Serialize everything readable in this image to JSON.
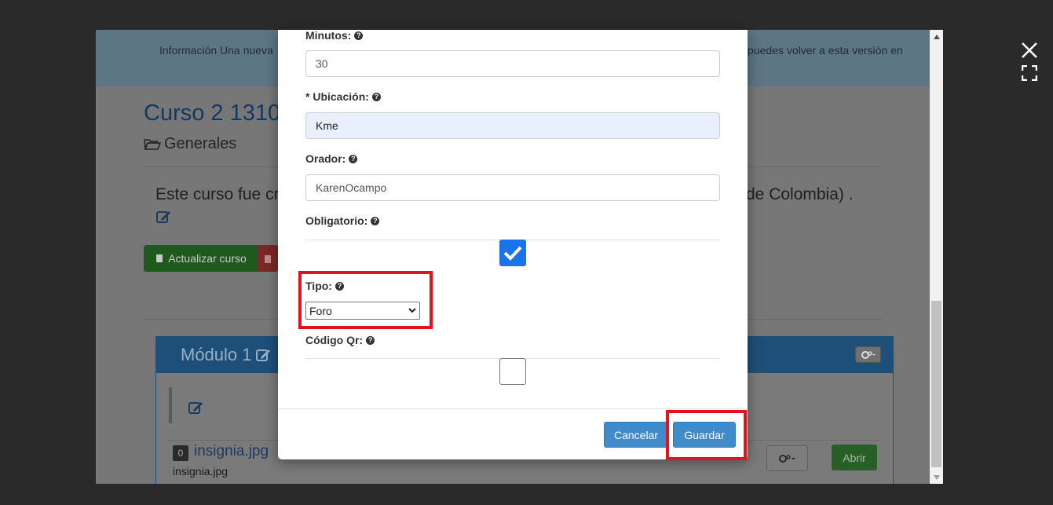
{
  "background_page": {
    "info_left": "Información Una nueva",
    "info_right": "puedes volver a esta versión en",
    "course_title": "Curso 2 1310",
    "course_category": "Generales",
    "description_left": "Este curso fue cr",
    "description_right": "de Colombia) .",
    "update_course_label": "Actualizar curso",
    "module_title": "Módulo 1",
    "file_count": "0",
    "file_link": "insignia.jpg",
    "file_name": "insignia.jpg",
    "open_label": "Abrir"
  },
  "modal": {
    "minutes_label": "Minutos:",
    "minutes_value": "30",
    "location_label": "* Ubicación:",
    "location_value": "Kme",
    "speaker_label": "Orador:",
    "speaker_value": "KarenOcampo",
    "mandatory_label": "Obligatorio:",
    "mandatory_checked": true,
    "type_label": "Tipo:",
    "type_value": "Foro",
    "qr_label": "Código Qr:",
    "qr_checked": false,
    "cancel_label": "Cancelar",
    "save_label": "Guardar"
  },
  "colors": {
    "primary": "#428bca",
    "checkbox_checked": "#1a73e8",
    "highlight": "#e0141e"
  }
}
